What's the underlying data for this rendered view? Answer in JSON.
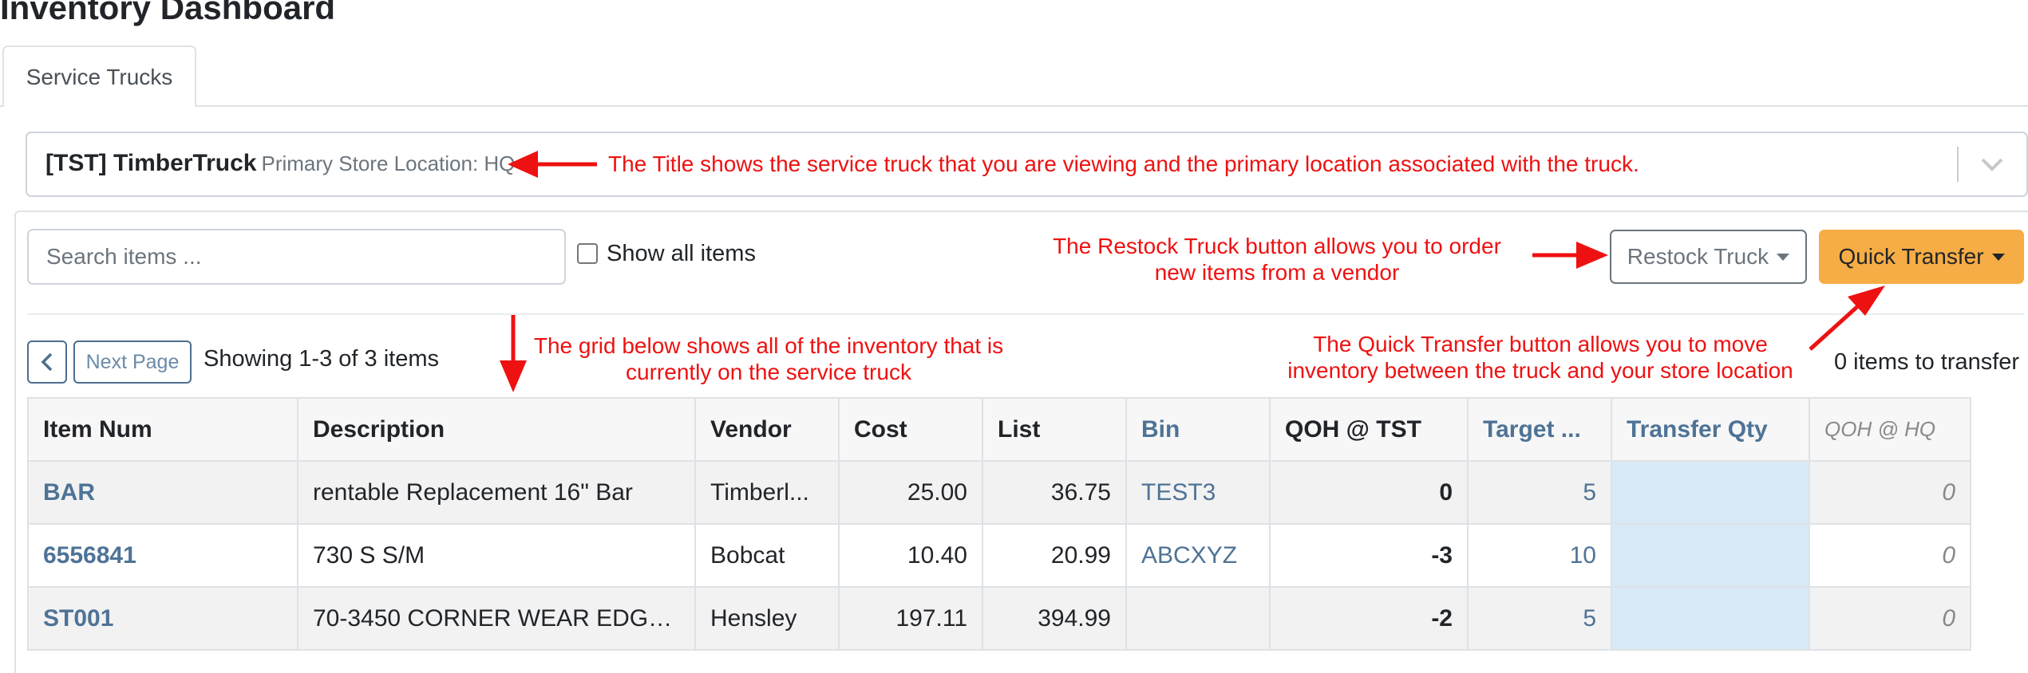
{
  "page": {
    "title": "Inventory Dashboard"
  },
  "tabs": [
    {
      "label": "Service Trucks"
    }
  ],
  "truck_select": {
    "truck": "[TST] TimberTruck",
    "location": "Primary Store Location: HQ"
  },
  "toolbar": {
    "search_placeholder": "Search items ...",
    "show_all_label": "Show all items",
    "restock_label": "Restock Truck",
    "quick_transfer_label": "Quick Transfer"
  },
  "pager": {
    "prev_icon": "chevron-left-icon",
    "next_label": "Next Page",
    "showing": "Showing 1-3 of 3 items",
    "to_transfer": "0 items to transfer"
  },
  "table": {
    "headers": [
      "Item Num",
      "Description",
      "Vendor",
      "Cost",
      "List",
      "Bin",
      "QOH @ TST",
      "Target ...",
      "Transfer Qty",
      "QOH @ HQ"
    ],
    "rows": [
      {
        "item": "BAR",
        "description": "rentable Replacement 16\" Bar",
        "vendor": "Timberl...",
        "cost": "25.00",
        "list": "36.75",
        "bin": "TEST3",
        "qoh": "0",
        "target": "5",
        "transfer": "",
        "hq": "0"
      },
      {
        "item": "6556841",
        "description": "730 S S/M",
        "vendor": "Bobcat",
        "cost": "10.40",
        "list": "20.99",
        "bin": "ABCXYZ",
        "qoh": "-3",
        "target": "10",
        "transfer": "",
        "hq": "0"
      },
      {
        "item": "ST001",
        "description": "70-3450 CORNER WEAR EDGE ...",
        "vendor": "Hensley",
        "cost": "197.11",
        "list": "394.99",
        "bin": "",
        "qoh": "-2",
        "target": "5",
        "transfer": "",
        "hq": "0"
      }
    ]
  },
  "annotations": {
    "title_note": "The Title shows the service truck that you are viewing and the primary location associated with the truck.",
    "restock_note_1": "The Restock Truck button allows you to order",
    "restock_note_2": "new items from a vendor",
    "grid_note_1": "The grid below shows all of the inventory that is",
    "grid_note_2": "currently on the service truck",
    "quick_note_1": "The Quick Transfer button allows you to move",
    "quick_note_2": "inventory between the truck and your store location"
  },
  "colors": {
    "accent": "#4e7396",
    "quick_transfer": "#f6ad45",
    "annotation": "#ee1111",
    "transfer_cell": "#d8eaf6"
  }
}
